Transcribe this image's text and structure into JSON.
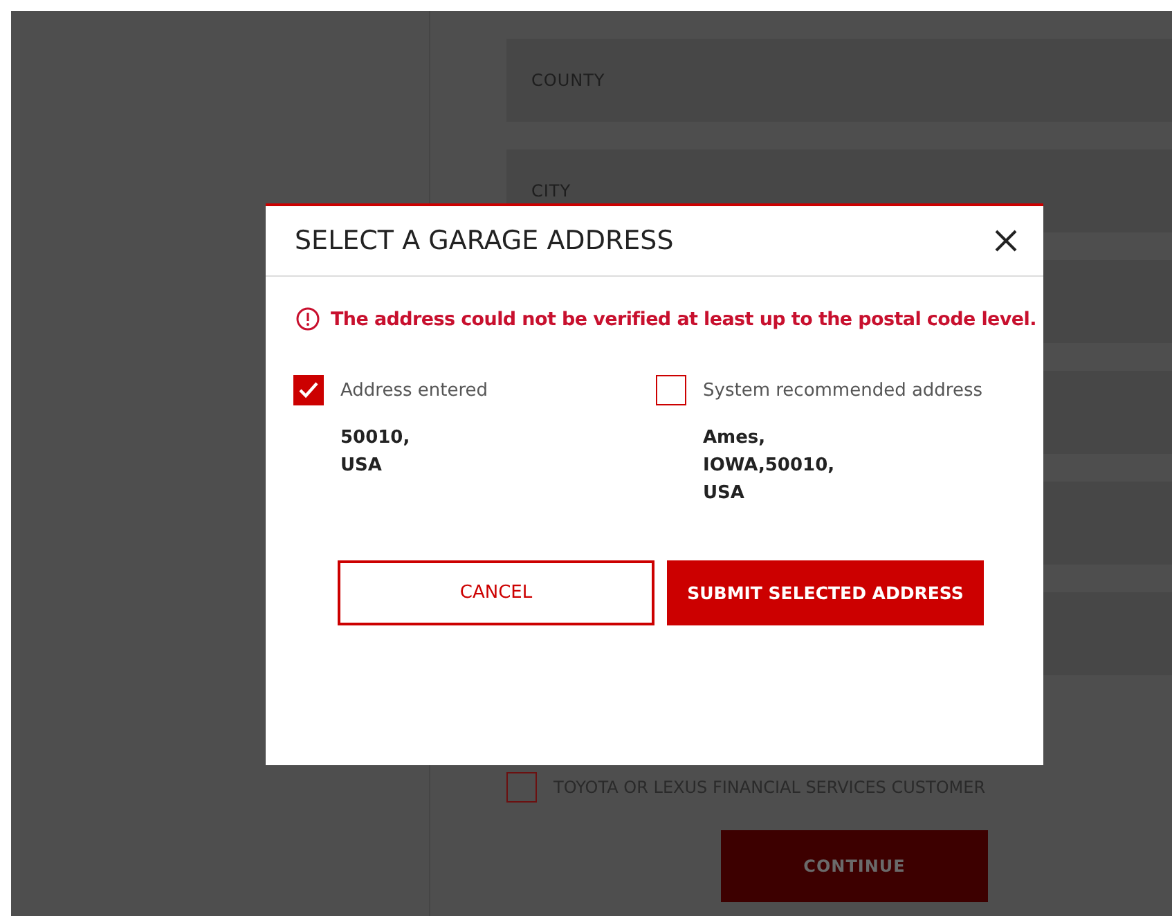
{
  "form": {
    "fields": [
      {
        "label": "COUNTY"
      },
      {
        "label": "CITY"
      }
    ],
    "financial_checkbox": {
      "label": "TOYOTA OR LEXUS FINANCIAL SERVICES CUSTOMER",
      "checked": false
    },
    "continue_button": "CONTINUE"
  },
  "dialog": {
    "title": "SELECT A GARAGE ADDRESS",
    "error": "The address could not be verified at least up to the postal code level.",
    "options": [
      {
        "label": "Address entered",
        "selected": true,
        "lines": [
          "50010,",
          "USA"
        ]
      },
      {
        "label": "System recommended address",
        "selected": false,
        "lines": [
          "Ames,",
          "IOWA,50010,",
          "USA"
        ]
      }
    ],
    "buttons": [
      {
        "kind": "secondary",
        "label": "CANCEL"
      },
      {
        "kind": "primary",
        "label": "SUBMIT SELECTED ADDRESS"
      }
    ]
  }
}
